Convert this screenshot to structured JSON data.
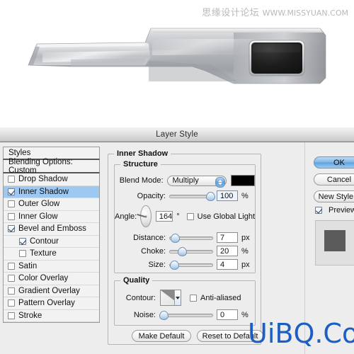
{
  "photo": {
    "watermark_cn": "思缘设计论坛",
    "watermark_url": "WWW.MISSYUAN.COM",
    "object_name": "metallic-device-render"
  },
  "dialog": {
    "title": "Layer Style"
  },
  "styles_panel": {
    "header": "Styles",
    "blending_options": "Blending Options: Custom",
    "effects": [
      {
        "label": "Drop Shadow",
        "checked": false,
        "selected": false,
        "indent": false
      },
      {
        "label": "Inner Shadow",
        "checked": true,
        "selected": true,
        "indent": false
      },
      {
        "label": "Outer Glow",
        "checked": false,
        "selected": false,
        "indent": false
      },
      {
        "label": "Inner Glow",
        "checked": false,
        "selected": false,
        "indent": false
      },
      {
        "label": "Bevel and Emboss",
        "checked": true,
        "selected": false,
        "indent": false
      },
      {
        "label": "Contour",
        "checked": true,
        "selected": false,
        "indent": true
      },
      {
        "label": "Texture",
        "checked": false,
        "selected": false,
        "indent": true
      },
      {
        "label": "Satin",
        "checked": false,
        "selected": false,
        "indent": false
      },
      {
        "label": "Color Overlay",
        "checked": false,
        "selected": false,
        "indent": false
      },
      {
        "label": "Gradient Overlay",
        "checked": false,
        "selected": false,
        "indent": false
      },
      {
        "label": "Pattern Overlay",
        "checked": false,
        "selected": false,
        "indent": false
      },
      {
        "label": "Stroke",
        "checked": false,
        "selected": false,
        "indent": false
      }
    ]
  },
  "inner_shadow": {
    "group_title": "Inner Shadow",
    "structure": {
      "legend": "Structure",
      "blend_mode_label": "Blend Mode:",
      "blend_mode_value": "Multiply",
      "shadow_color": "#000000",
      "opacity_label": "Opacity:",
      "opacity_value": "100",
      "opacity_unit": "%",
      "angle_label": "Angle:",
      "angle_value": "164",
      "angle_unit": "°",
      "use_global_light_label": "Use Global Light",
      "use_global_light_checked": false,
      "distance_label": "Distance:",
      "distance_value": "7",
      "distance_unit": "px",
      "choke_label": "Choke:",
      "choke_value": "20",
      "choke_unit": "%",
      "size_label": "Size:",
      "size_value": "4",
      "size_unit": "px"
    },
    "quality": {
      "legend": "Quality",
      "contour_label": "Contour:",
      "anti_aliased_label": "Anti-aliased",
      "anti_aliased_checked": false,
      "noise_label": "Noise:",
      "noise_value": "0",
      "noise_unit": "%"
    },
    "footer": {
      "make_default": "Make Default",
      "reset_to_default": "Reset to Default"
    }
  },
  "buttons": {
    "ok": "OK",
    "cancel": "Cancel",
    "new_style": "New Style...",
    "preview_label": "Preview",
    "preview_checked": true
  },
  "watermark_bottom": {
    "text": "UiBQ.CoM",
    "color": "#1c5fc4"
  },
  "colors": {
    "dialog_bg": "#ededed",
    "selection_blue": "#9cc8f2",
    "accent_blue": "#5fa0de"
  }
}
